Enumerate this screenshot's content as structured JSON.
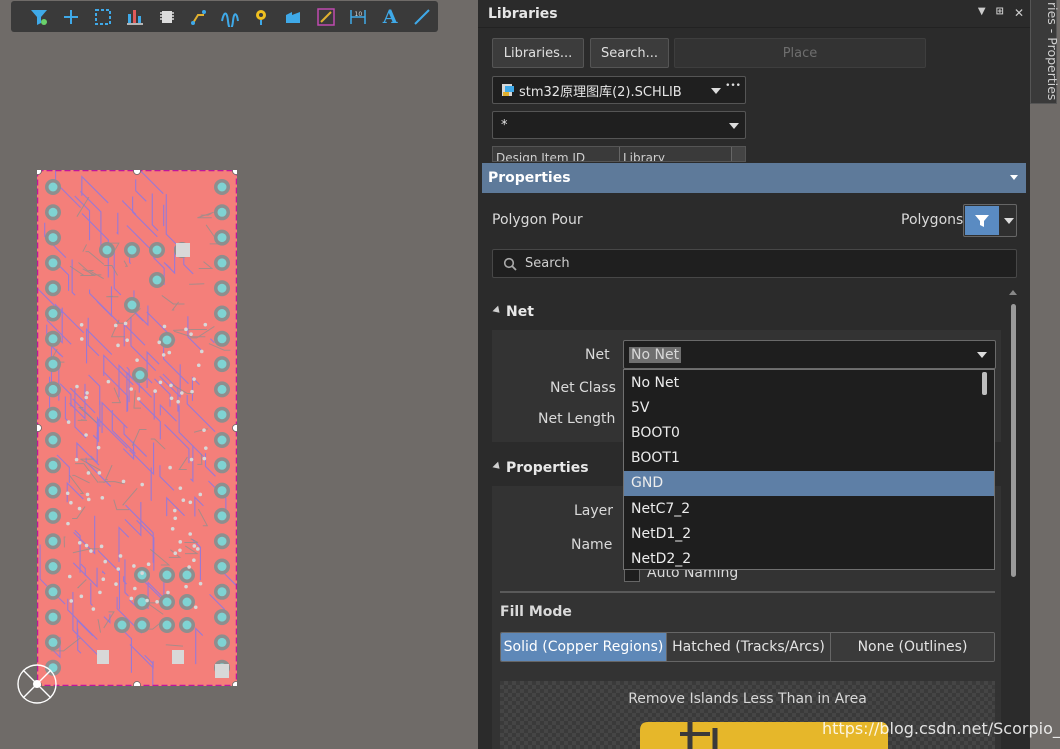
{
  "toolbar": {
    "icons": [
      "filter-icon",
      "crosshair-icon",
      "select-rect-icon",
      "align-icon",
      "component-icon",
      "route-icon",
      "interactive-route-icon",
      "via-icon",
      "polygon-icon",
      "keepout-icon",
      "dimension-icon",
      "text-icon",
      "line-icon"
    ],
    "text_icon_glyph": "A"
  },
  "libraries": {
    "title": "Libraries",
    "libraries_button": "Libraries...",
    "search_button": "Search...",
    "place_button": "Place",
    "library_select": "stm32原理图库(2).SCHLIB",
    "more_glyph": "•••",
    "filter_value": "*",
    "col_design_item": "Design Item ID",
    "col_library": "Library"
  },
  "side_tab": {
    "label": "ries - Properties"
  },
  "properties": {
    "title": "Properties",
    "object_type": "Polygon Pour",
    "filter_label": "Polygons",
    "search_placeholder": "Search",
    "net_section": "Net",
    "net_label": "Net",
    "net_value": "No Net",
    "net_class_label": "Net Class",
    "net_length_label": "Net Length",
    "net_options": [
      "No Net",
      "5V",
      "BOOT0",
      "BOOT1",
      "GND",
      "NetC7_2",
      "NetD1_2",
      "NetD2_2"
    ],
    "selected_option_index": 4,
    "props_section": "Properties",
    "layer_label": "Layer",
    "name_label": "Name",
    "auto_naming": "Auto Naming",
    "fill_mode_label": "Fill Mode",
    "fill_modes": [
      "Solid (Copper Regions)",
      "Hatched (Tracks/Arcs)",
      "None (Outlines)"
    ],
    "active_fill_mode": "Solid (Copper Regions)",
    "islands_label": "Remove Islands Less Than in Area"
  },
  "watermark": "https://blog.csdn.net/Scorpio_L_",
  "colors": {
    "canvas": "#6f6b68",
    "board_copper": "#f47f7a",
    "selection_outline": "#c0169c",
    "panel_header": "#5e7a9a",
    "selected_item": "#5e7fa6",
    "accent_blue": "#5a8bc2"
  }
}
